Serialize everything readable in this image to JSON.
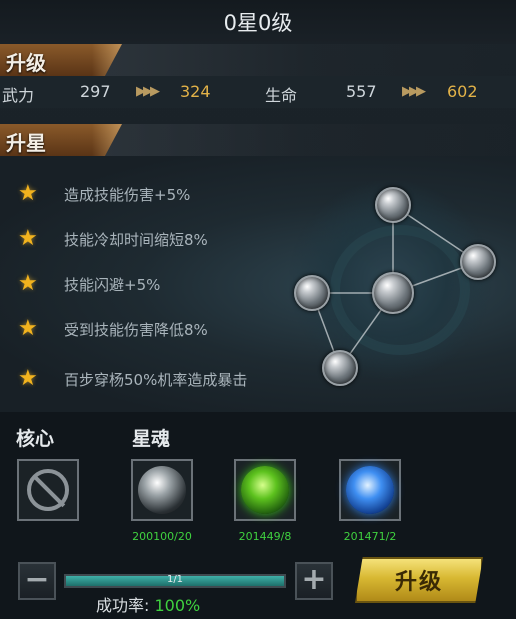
{
  "header": {
    "title": "0星0级"
  },
  "upgrade_section": {
    "label": "升级"
  },
  "stats": {
    "attack": {
      "label": "武力",
      "current": "297",
      "next": "324"
    },
    "life": {
      "label": "生命",
      "current": "557",
      "next": "602"
    }
  },
  "star_section": {
    "label": "升星"
  },
  "star_bonuses": [
    "造成技能伤害+5%",
    "技能冷却时间缩短8%",
    "技能闪避+5%",
    "受到技能伤害降低8%",
    "百步穿杨50%机率造成暴击"
  ],
  "core": {
    "label": "核心"
  },
  "souls": {
    "label": "星魂",
    "items": [
      {
        "id_count": "200100/20",
        "color": "#9aa2a6"
      },
      {
        "id_count": "201449/8",
        "color": "#5dc21e"
      },
      {
        "id_count": "201471/2",
        "color": "#3f8ff2"
      }
    ]
  },
  "progress": {
    "text": "1/1",
    "fraction": 1.0
  },
  "success": {
    "label": "成功率:",
    "value": "100%"
  },
  "buttons": {
    "minus": "−",
    "plus": "+",
    "upgrade": "升级"
  },
  "colors": {
    "accent_gold": "#e2b248",
    "success_green": "#3fd13f"
  }
}
